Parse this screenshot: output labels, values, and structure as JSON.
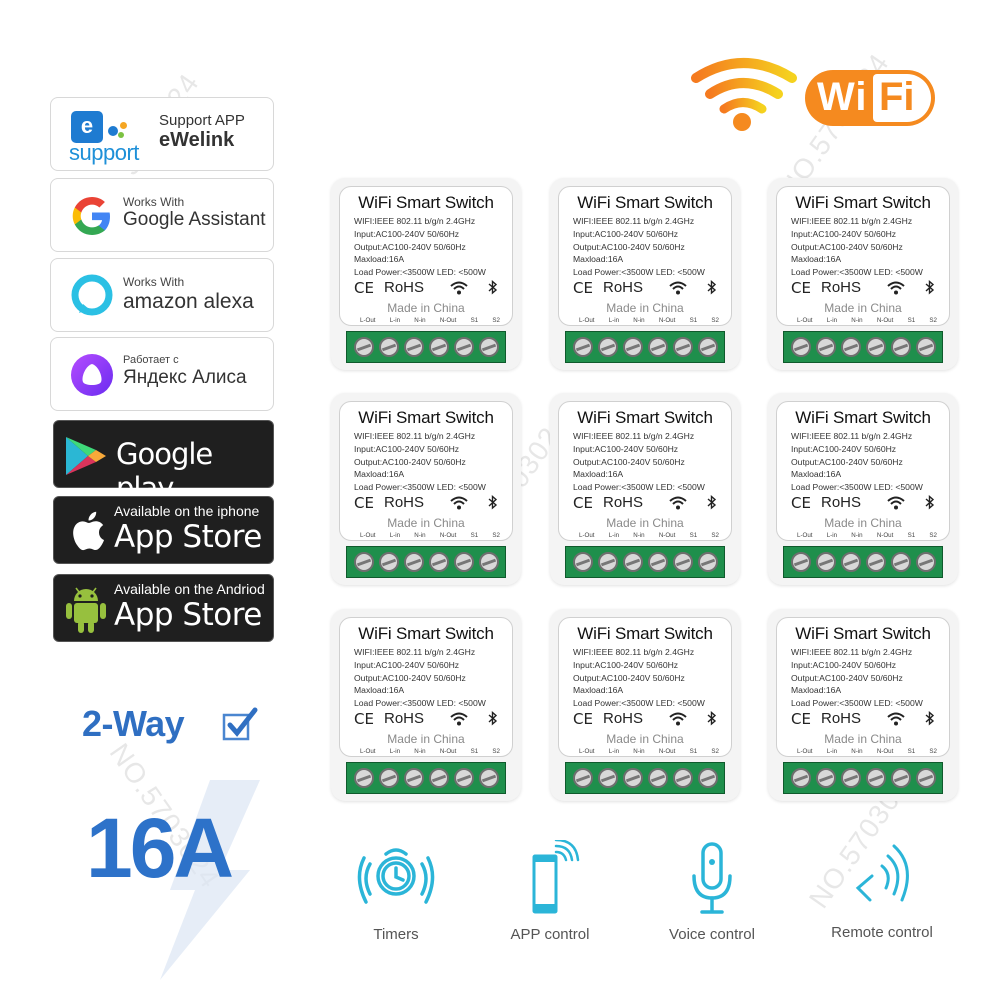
{
  "badges": {
    "ewelink": {
      "logo_letter": "e",
      "logo_word": "support",
      "line1": "Support APP",
      "line2": "eWelink"
    },
    "google_assistant": {
      "line1": "Works With",
      "line2": "Google Assistant"
    },
    "alexa": {
      "line1": "Works With",
      "line2": "amazon alexa"
    },
    "yandex": {
      "line1": "Работает с",
      "line2": "Яндекс Алиса"
    },
    "google_play": {
      "label": "Google play"
    },
    "ios_store": {
      "line1": "Available on the iphone",
      "line2": "App Store"
    },
    "android_store": {
      "line1": "Available on the Andriod",
      "line2": "App Store"
    }
  },
  "wifi_logo": {
    "text_wi": "Wi",
    "text_fi": "Fi"
  },
  "features_left": {
    "two_way": "2-Way",
    "amperage": "16A"
  },
  "switch_label": {
    "title": "WiFi Smart Switch",
    "specs": [
      "WIFI:IEEE 802.11 b/g/n 2.4GHz",
      "Input:AC100-240V 50/60Hz",
      "Output:AC100-240V 50/60Hz",
      "Maxload:16A",
      "Load Power:<3500W LED: <500W"
    ],
    "ce": "CE",
    "rohs": "RoHS",
    "made_in": "Made in China",
    "terminals": [
      "L-Out",
      "L-in",
      "N-in",
      "N-Out",
      "S1",
      "S2"
    ]
  },
  "switch_grid": {
    "rows": 3,
    "cols": 3,
    "count": 9
  },
  "features": [
    {
      "icon": "alarm-clock-icon",
      "label": "Timers"
    },
    {
      "icon": "smartphone-wifi-icon",
      "label": "APP control"
    },
    {
      "icon": "microphone-icon",
      "label": "Voice control"
    },
    {
      "icon": "remote-signal-icon",
      "label": "Remote control"
    }
  ],
  "watermark": "NO.5703024",
  "colors": {
    "accent_blue": "#2d72c9",
    "feature_cyan": "#2bb5d8",
    "wifi_orange": "#f58a1f",
    "terminal_green": "#1f8f4c",
    "badge_dark": "#1f1f1f"
  }
}
